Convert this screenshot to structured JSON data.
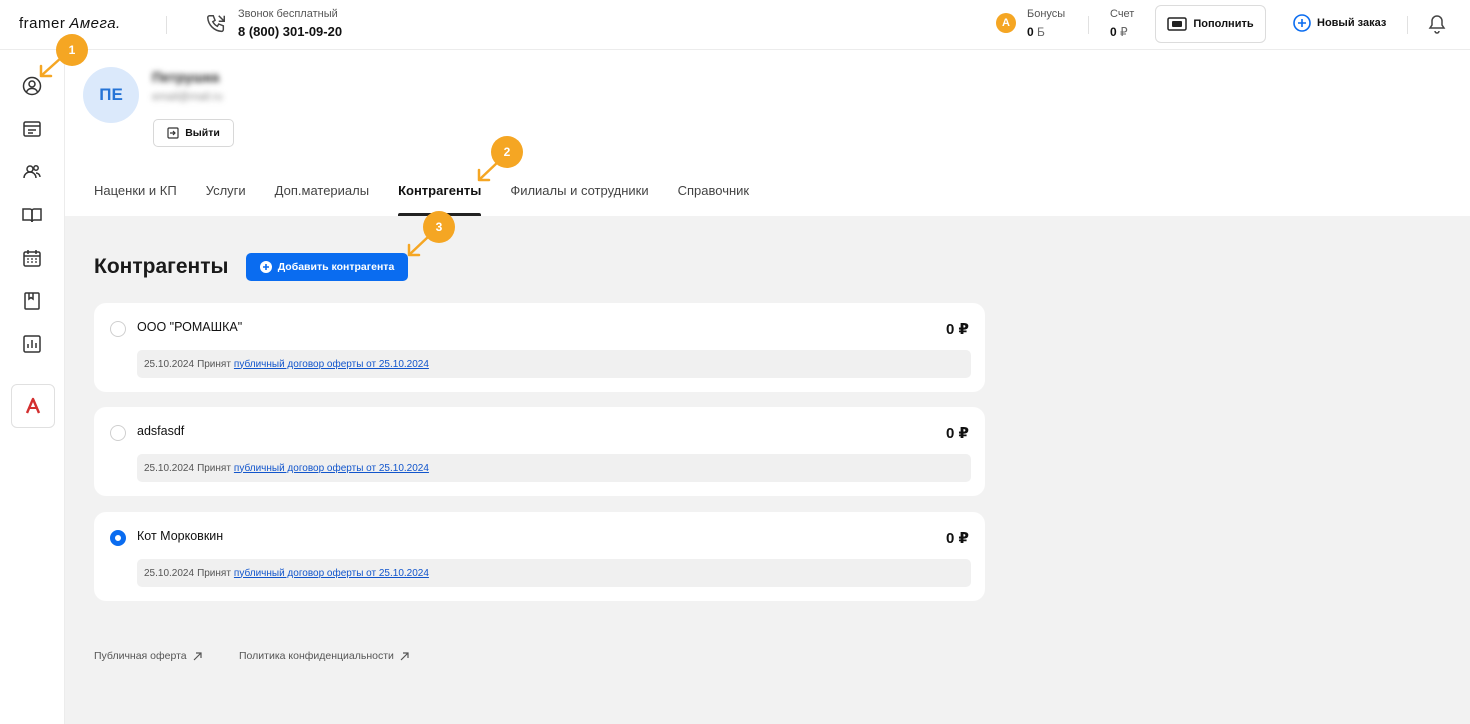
{
  "header": {
    "logo_framer": "framer",
    "logo_amega": "Амега.",
    "phone_label": "Звонок бесплатный",
    "phone_number": "8 (800) 301-09-20",
    "bonus_badge": "A",
    "bonus_label": "Бонусы",
    "bonus_value": "0",
    "bonus_unit": "Б",
    "account_label": "Счет",
    "account_value": "0",
    "account_unit": "₽",
    "topup_label": "Пополнить",
    "new_order_label": "Новый заказ"
  },
  "sidebar": {
    "items": [
      {
        "icon": "user-circle-icon"
      },
      {
        "icon": "orders-icon"
      },
      {
        "icon": "users-icon"
      },
      {
        "icon": "book-icon"
      },
      {
        "icon": "calendar-icon"
      },
      {
        "icon": "portfolio-icon"
      },
      {
        "icon": "stats-icon"
      }
    ],
    "app_icon": "amega-app-icon"
  },
  "profile": {
    "initials": "ПЕ",
    "name": "Петрушка",
    "email": "email@mail.ru",
    "logout_label": "Выйти"
  },
  "tabs": [
    {
      "label": "Наценки и КП",
      "active": false
    },
    {
      "label": "Услуги",
      "active": false
    },
    {
      "label": "Доп.материалы",
      "active": false
    },
    {
      "label": "Контрагенты",
      "active": true
    },
    {
      "label": "Филиалы и сотрудники",
      "active": false
    },
    {
      "label": "Справочник",
      "active": false
    }
  ],
  "main": {
    "title": "Контрагенты",
    "add_button_label": "Добавить контрагента"
  },
  "contractors": [
    {
      "name": "ООО \"РОМАШКА\"",
      "amount": "0 ₽",
      "selected": false,
      "date": "25.10.2024",
      "status": "Принят",
      "link": "публичный договор оферты от 25.10.2024"
    },
    {
      "name": "adsfasdf",
      "amount": "0 ₽",
      "selected": false,
      "date": "25.10.2024",
      "status": "Принят",
      "link": "публичный договор оферты от 25.10.2024"
    },
    {
      "name": "Кот Морковкин",
      "amount": "0 ₽",
      "selected": true,
      "date": "25.10.2024",
      "status": "Принят",
      "link": "публичный договор оферты от 25.10.2024"
    }
  ],
  "footer": {
    "offer_link": "Публичная оферта",
    "privacy_link": "Политика конфиденциальности"
  },
  "annotations": {
    "marker_1": "1",
    "marker_2": "2",
    "marker_3": "3"
  },
  "colors": {
    "accent": "#0a6cf0",
    "marker": "#f5a623",
    "avatar_bg": "#dbe9fb",
    "avatar_text": "#2674d6",
    "main_bg": "#f2f2f2"
  }
}
